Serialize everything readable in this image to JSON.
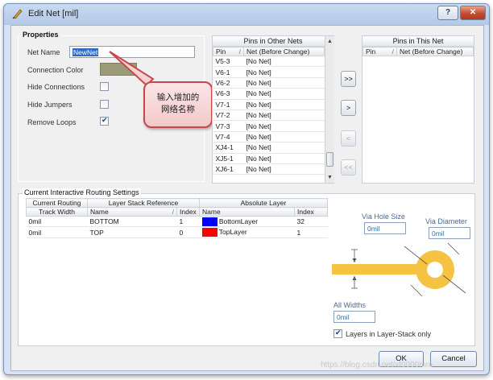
{
  "window": {
    "title": "Edit Net [mil]",
    "help": "?",
    "close": "✕"
  },
  "properties": {
    "group_title": "Properties",
    "net_name_label": "Net Name",
    "net_name_value": "NewNet",
    "connection_color_label": "Connection Color",
    "connection_color": "#9b9c77",
    "hide_connections_label": "Hide Connections",
    "hide_connections": false,
    "hide_jumpers_label": "Hide Jumpers",
    "hide_jumpers": false,
    "remove_loops_label": "Remove Loops",
    "remove_loops": true
  },
  "callout": {
    "line1": "输入增加的",
    "line2": "网络名称"
  },
  "pins_other": {
    "title": "Pins in Other Nets",
    "col_pin": "Pin",
    "col_sort": "/",
    "col_net": "Net (Before Change)",
    "rows": [
      {
        "pin": "V5-3",
        "net": "[No Net]"
      },
      {
        "pin": "V6-1",
        "net": "[No Net]"
      },
      {
        "pin": "V6-2",
        "net": "[No Net]"
      },
      {
        "pin": "V6-3",
        "net": "[No Net]"
      },
      {
        "pin": "V7-1",
        "net": "[No Net]"
      },
      {
        "pin": "V7-2",
        "net": "[No Net]"
      },
      {
        "pin": "V7-3",
        "net": "[No Net]"
      },
      {
        "pin": "V7-4",
        "net": "[No Net]"
      },
      {
        "pin": "XJ4-1",
        "net": "[No Net]"
      },
      {
        "pin": "XJ5-1",
        "net": "[No Net]"
      },
      {
        "pin": "XJ6-1",
        "net": "[No Net]"
      }
    ]
  },
  "move_buttons": {
    "add_all": ">>",
    "add": ">",
    "remove": "<",
    "remove_all": "<<"
  },
  "pins_this": {
    "title": "Pins in This Net",
    "col_pin": "Pin",
    "col_sort": "/",
    "col_net": "Net (Before Change)"
  },
  "routing": {
    "group_title": "Current Interactive Routing Settings",
    "h_current": "Current Routing",
    "h_layerstack": "Layer Stack Reference",
    "h_absolute": "Absolute Layer",
    "h_track_width": "Track Width",
    "h_name": "Name",
    "h_sort": "/",
    "h_index": "Index",
    "h_abs_name": "Name",
    "h_abs_index": "Index",
    "rows": [
      {
        "width": "0mil",
        "name": "BOTTOM",
        "index": "1",
        "color": "#0000ff",
        "layer": "BottomLayer",
        "layer_index": "32"
      },
      {
        "width": "0mil",
        "name": "TOP",
        "index": "0",
        "color": "#ff0000",
        "layer": "TopLayer",
        "layer_index": "1"
      }
    ]
  },
  "via": {
    "hole_size_label": "Via Hole Size",
    "hole_size": "0mil",
    "diameter_label": "Via Diameter",
    "diameter": "0mil",
    "all_widths_label": "All Widths",
    "all_widths": "0mil",
    "layers_only_label": "Layers in Layer-Stack only",
    "layers_only": true,
    "pad_color": "#f5c242"
  },
  "buttons": {
    "ok": "OK",
    "cancel": "Cancel"
  },
  "watermark": "https://blog.csdn.net/xf0000mm"
}
